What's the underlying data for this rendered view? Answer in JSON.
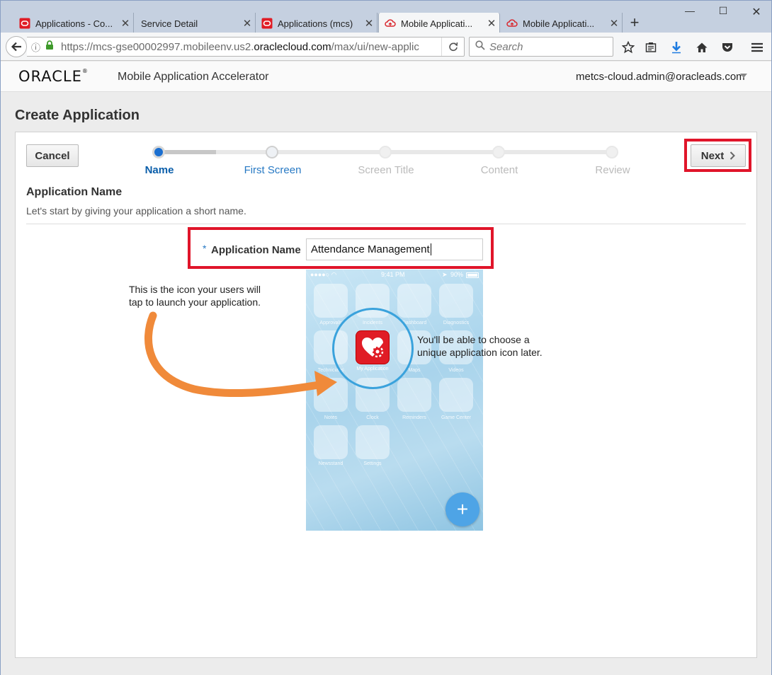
{
  "browser": {
    "tabs": [
      {
        "title": "Applications - Co...",
        "icon": "oracle-icon"
      },
      {
        "title": "Service Detail",
        "icon": "none"
      },
      {
        "title": "Applications (mcs)",
        "icon": "oracle-icon"
      },
      {
        "title": "Mobile Applicati...",
        "icon": "cloud-icon"
      },
      {
        "title": "Mobile Applicati...",
        "icon": "cloud-icon"
      }
    ],
    "url_prefix": "https://mcs-gse00002997.mobileenv.us2.",
    "url_domain": "oraclecloud.com",
    "url_suffix": "/max/ui/new-applic",
    "search_placeholder": "Search"
  },
  "header": {
    "logo": "ORACLE",
    "logo_mark": "®",
    "app_name": "Mobile Application Accelerator",
    "user": "metcs-cloud.admin@oracleads.com"
  },
  "page": {
    "title": "Create Application",
    "cancel_label": "Cancel",
    "next_label": "Next"
  },
  "train": {
    "steps": [
      "Name",
      "First Screen",
      "Screen Title",
      "Content",
      "Review"
    ],
    "current_index": 0
  },
  "section": {
    "title": "Application Name",
    "description": "Let's start by giving your application a short name."
  },
  "form": {
    "required_mark": "*",
    "label": "Application Name",
    "value": "Attendance Management"
  },
  "preview": {
    "note_icon": "This is the icon your users will tap to launch your application.",
    "note_choose": "You'll be able to choose a unique application icon later.",
    "status_time": "9:41 PM",
    "status_battery": "90%",
    "app_labels": [
      "Approvals",
      "Incidents",
      "Dashboard",
      "Diagnostics",
      "Technicians",
      "My Application",
      "Maps",
      "Videos",
      "Notes",
      "Clock",
      "Reminders",
      "Game Center",
      "Newsstand",
      "Settings"
    ],
    "fab_label": "+"
  },
  "colors": {
    "accent_blue": "#0a5eaa",
    "highlight_red": "#e0152a",
    "oracle_red": "#e01c25"
  }
}
